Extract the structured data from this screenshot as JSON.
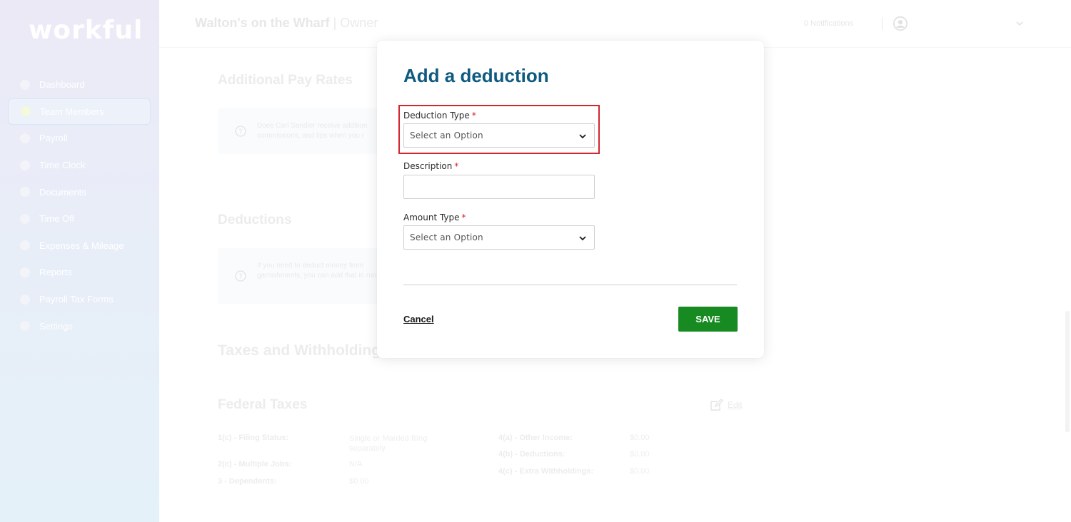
{
  "app": {
    "logo_text": "workful"
  },
  "sidebar": {
    "items": [
      {
        "label": "Dashboard"
      },
      {
        "label": "Team Members"
      },
      {
        "label": "Payroll"
      },
      {
        "label": "Time Clock"
      },
      {
        "label": "Documents"
      },
      {
        "label": "Time Off"
      },
      {
        "label": "Expenses & Mileage"
      },
      {
        "label": "Reports"
      },
      {
        "label": "Payroll Tax Forms"
      },
      {
        "label": "Settings"
      }
    ]
  },
  "header": {
    "business_name": "Walton's on the Wharf",
    "role": "| Owner",
    "notifications": "0 Notifications"
  },
  "background": {
    "additional_pay_rates_title": "Additional Pay Rates",
    "additional_pay_rates_help": "Does Carl Sandler receive addition commissions, and tips when you r",
    "deductions_title": "Deductions",
    "deductions_help": "If you need to deduct money from garnishments, you can add that in runs.",
    "taxes_title": "Taxes and Withholding",
    "federal_title": "Federal Taxes",
    "edit_label": "Edit",
    "federal_fields": [
      {
        "label": "1(c) - Filing Status:",
        "value": "Single or Married filing separately"
      },
      {
        "label": "2(c) - Multiple Jobs:",
        "value": "N/A"
      },
      {
        "label": "3 - Dependents:",
        "value": "$0.00"
      },
      {
        "label": "4(a) - Other Income:",
        "value": "$0.00"
      },
      {
        "label": "4(b) - Deductions:",
        "value": "$0.00"
      },
      {
        "label": "4(c) - Extra Withholdings:",
        "value": "$0.00"
      }
    ]
  },
  "modal": {
    "title": "Add a deduction",
    "deduction_type": {
      "label": "Deduction Type",
      "required_mark": "*",
      "placeholder": "Select an Option"
    },
    "description": {
      "label": "Description",
      "required_mark": "*",
      "value": ""
    },
    "amount_type": {
      "label": "Amount Type",
      "required_mark": "*",
      "placeholder": "Select an Option"
    },
    "cancel_label": "Cancel",
    "save_label": "SAVE"
  },
  "colors": {
    "title_blue": "#0e5a80",
    "save_green": "#178a21",
    "highlight_red": "#d22630",
    "required_red": "#d2232a"
  }
}
